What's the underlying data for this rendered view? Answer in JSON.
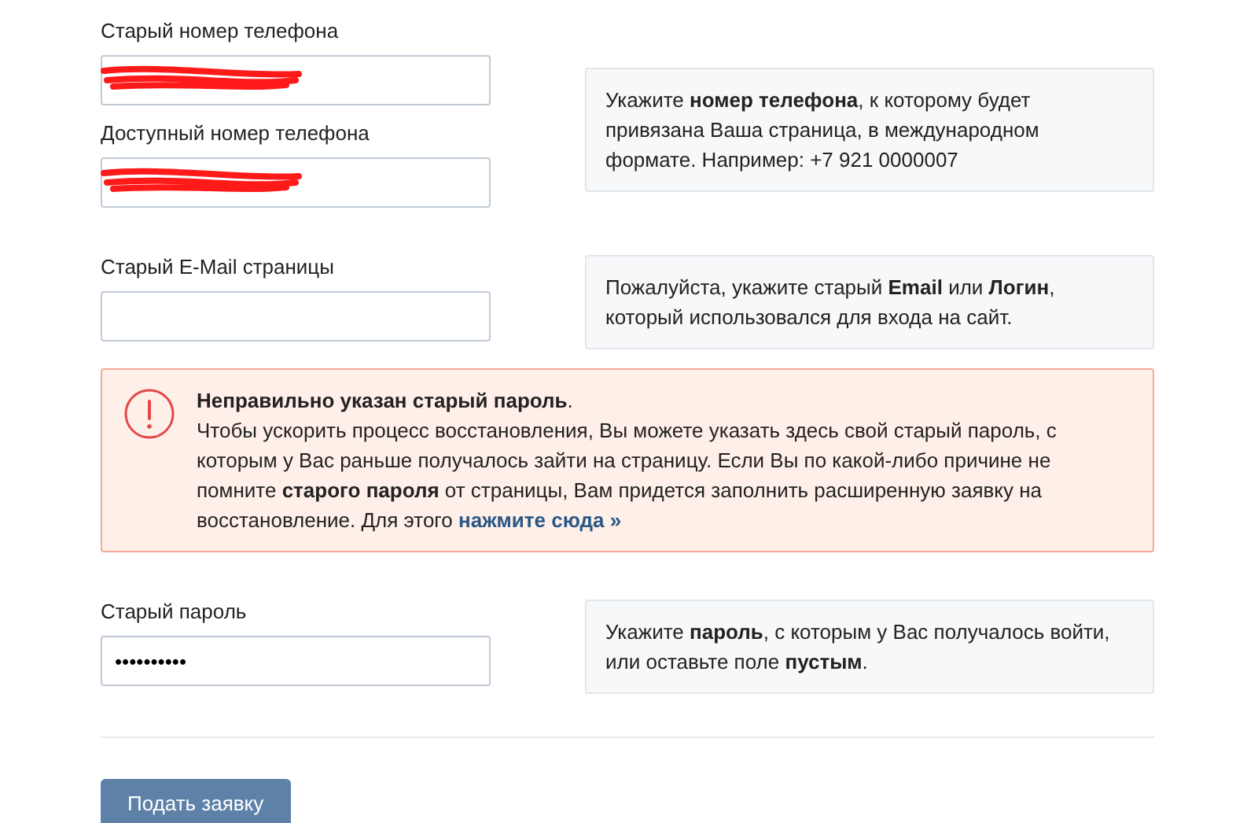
{
  "sections": [
    {
      "fields": [
        {
          "label": "Старый номер телефона",
          "redacted": true
        },
        {
          "label": "Доступный номер телефона",
          "redacted": true
        }
      ],
      "hint": "Укажите **номер телефона**, к которому будет привязана Ваша страница, в международном формате. Например: +7 921 0000007"
    },
    {
      "fields": [
        {
          "label": "Старый E-Mail страницы",
          "redacted": false
        }
      ],
      "hint": "Пожалуйста, укажите старый **Email** или **Логин**, который использовался для входа на сайт."
    }
  ],
  "error": {
    "title": "**Неправильно указан старый пароль**.",
    "text": "Чтобы ускорить процесс восстановления, Вы можете указать здесь свой старый пароль, с которым у Вас раньше получалось зайти на страницу. Если Вы по какой-либо причине не помните **старого пароля** от страницы, Вам придется заполнить расширенную заявку на восстановление. Для этого",
    "link": "нажмите сюда »"
  },
  "password": {
    "label": "Старый пароль",
    "value": "••••••••••",
    "hint": "Укажите **пароль**, с которым у Вас получалось войти, или оставьте поле **пустым**."
  },
  "submit": "Подать заявку"
}
